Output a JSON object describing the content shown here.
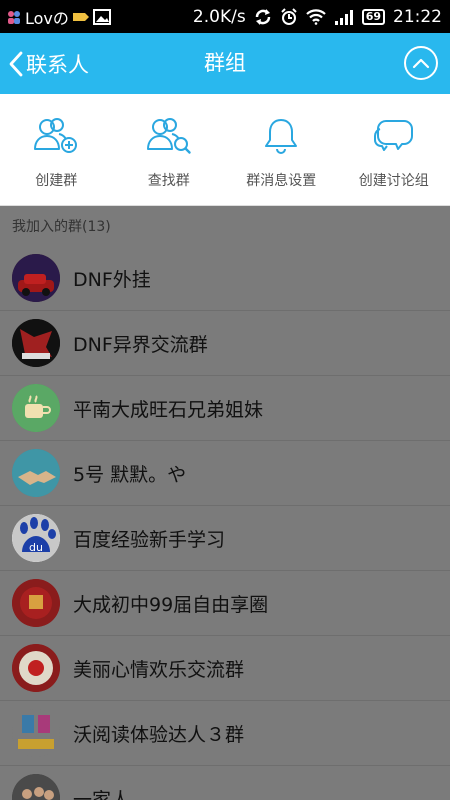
{
  "status_bar": {
    "carrier_text": "Lovの",
    "net_speed": "2.0K/s",
    "battery": "69",
    "time": "21:22"
  },
  "title_bar": {
    "back_label": "联系人",
    "title": "群组"
  },
  "actions": [
    {
      "label": "创建群",
      "icon": "create-group-icon"
    },
    {
      "label": "查找群",
      "icon": "find-group-icon"
    },
    {
      "label": "群消息设置",
      "icon": "bell-icon"
    },
    {
      "label": "创建讨论组",
      "icon": "chat-bubbles-icon"
    }
  ],
  "groups_section": {
    "header": "我加入的群(13)",
    "items": [
      {
        "name": "DNF外挂",
        "avatar_color": "#5a2a2a"
      },
      {
        "name": "DNF异界交流群",
        "avatar_color": "#1a1a1a"
      },
      {
        "name": "平南大成旺石兄弟姐妹",
        "avatar_color": "#4fa05a"
      },
      {
        "name": "5号  默默。や",
        "avatar_color": "#3a8fa0"
      },
      {
        "name": "百度经验新手学习",
        "avatar_color": "#1c3fa8"
      },
      {
        "name": "大成初中99届自由享圈",
        "avatar_color": "#8a1c1c"
      },
      {
        "name": "美丽心情欢乐交流群",
        "avatar_color": "#8a1c1c"
      },
      {
        "name": "沃阅读体验达人３群",
        "avatar_color": "#6a6a6a"
      },
      {
        "name": "一家人",
        "avatar_color": "#3a3a3a"
      }
    ]
  },
  "colors": {
    "accent": "#29b8ee",
    "overlay": "#7b7b7b",
    "icon_blue": "#2aa7e0"
  }
}
